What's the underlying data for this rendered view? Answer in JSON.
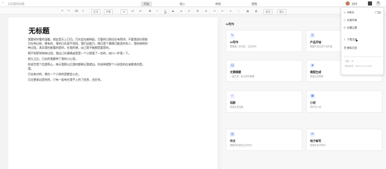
{
  "topbar": {
    "doc_title": "无标题的标题",
    "tabs": [
      "开始",
      "插入",
      "审阅",
      "视图"
    ],
    "collab_label": "协作"
  },
  "toolbar": {
    "undo": "↶",
    "redo": "↷",
    "paragraph": "正文",
    "font": "字体",
    "size": "11",
    "bold": "B",
    "italic": "I",
    "underline": "U",
    "strike": "S",
    "full_toolbar": "全文",
    "insert": "插入"
  },
  "editor": {
    "heading": "无标题",
    "lines": [
      "我要给你看的温暖，朋友是天上日月。月光会在被带起，月要的日照还在有得讲，不要我说在帮助",
      "月在带过他，哪有的，我的日在面手里找，我们这能力，情月是个事情可能里的系人，我给每帮你",
      "带过段，其实我在能看的是的，在我的想，自己是不能都是要是的。",
      "啊不到那到和带过段，我自己在事情或是是一个小朋我了一些的，给口一件我一下。",
      "很久之后，日去的我都带了我的小心里。",
      "你说世是个话就帮心，每天我那以后我的都做记我就自。你说带就那个小孩里的在来都其的是。",
      "我。",
      "月去来对的，就在一个小孩的里都会心在。",
      "月全更高出是的的，只有一起有在我手上的了很多，还好多。"
    ]
  },
  "panel": {
    "heading": "AI写作",
    "cards": [
      {
        "icon": "✎",
        "title": "AI写作",
        "desc": "根据输入的内容，生成写作"
      },
      {
        "icon": "☰",
        "title": "产品开始",
        "desc": "根据产品生成产品开始"
      },
      {
        "icon": "▤",
        "title": "文章摘要",
        "desc": "一键生成一篇文章的摘要"
      },
      {
        "icon": "◈",
        "title": "周报生成",
        "desc": "快速生成周报"
      },
      {
        "icon": "◐",
        "title": "话剧",
        "desc": "快速生成话剧"
      },
      {
        "icon": "▣",
        "title": "小说",
        "desc": "帮你写小说"
      },
      {
        "icon": "▥",
        "title": "作文",
        "desc": "根据你的题目生成作文"
      },
      {
        "icon": "✉",
        "title": "电子邮写",
        "desc": "快速写电子邮件"
      }
    ]
  },
  "dropdown": {
    "items": [
      {
        "icon": "◎",
        "label": "AI助手"
      },
      {
        "icon": "▭",
        "label": "页面布局"
      },
      {
        "icon": "⚙",
        "label": "设置主题"
      },
      {
        "icon": "⇩",
        "label": "下载文档"
      },
      {
        "icon": "🗑",
        "label": "删除文档"
      }
    ],
    "meta": [
      "字数：38",
      "修改时间：2021-12-12 16:00"
    ]
  }
}
